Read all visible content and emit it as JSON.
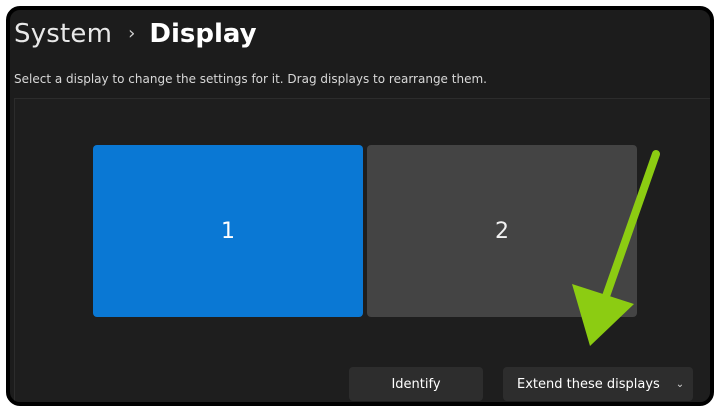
{
  "header": {
    "parent": "System",
    "separator": "›",
    "current": "Display"
  },
  "subtitle": "Select a display to change the settings for it. Drag displays to rearrange them.",
  "monitors": [
    {
      "label": "1",
      "selected": true
    },
    {
      "label": "2",
      "selected": false
    }
  ],
  "buttons": {
    "identify": "Identify",
    "extend": "Extend these displays",
    "extend_chevron": "⌄"
  },
  "colors": {
    "accent": "#0a78d4",
    "annotation_arrow": "#8ccc12"
  },
  "icons": {
    "annotation": "arrow-down-left-icon",
    "dropdown": "chevron-down-icon"
  }
}
